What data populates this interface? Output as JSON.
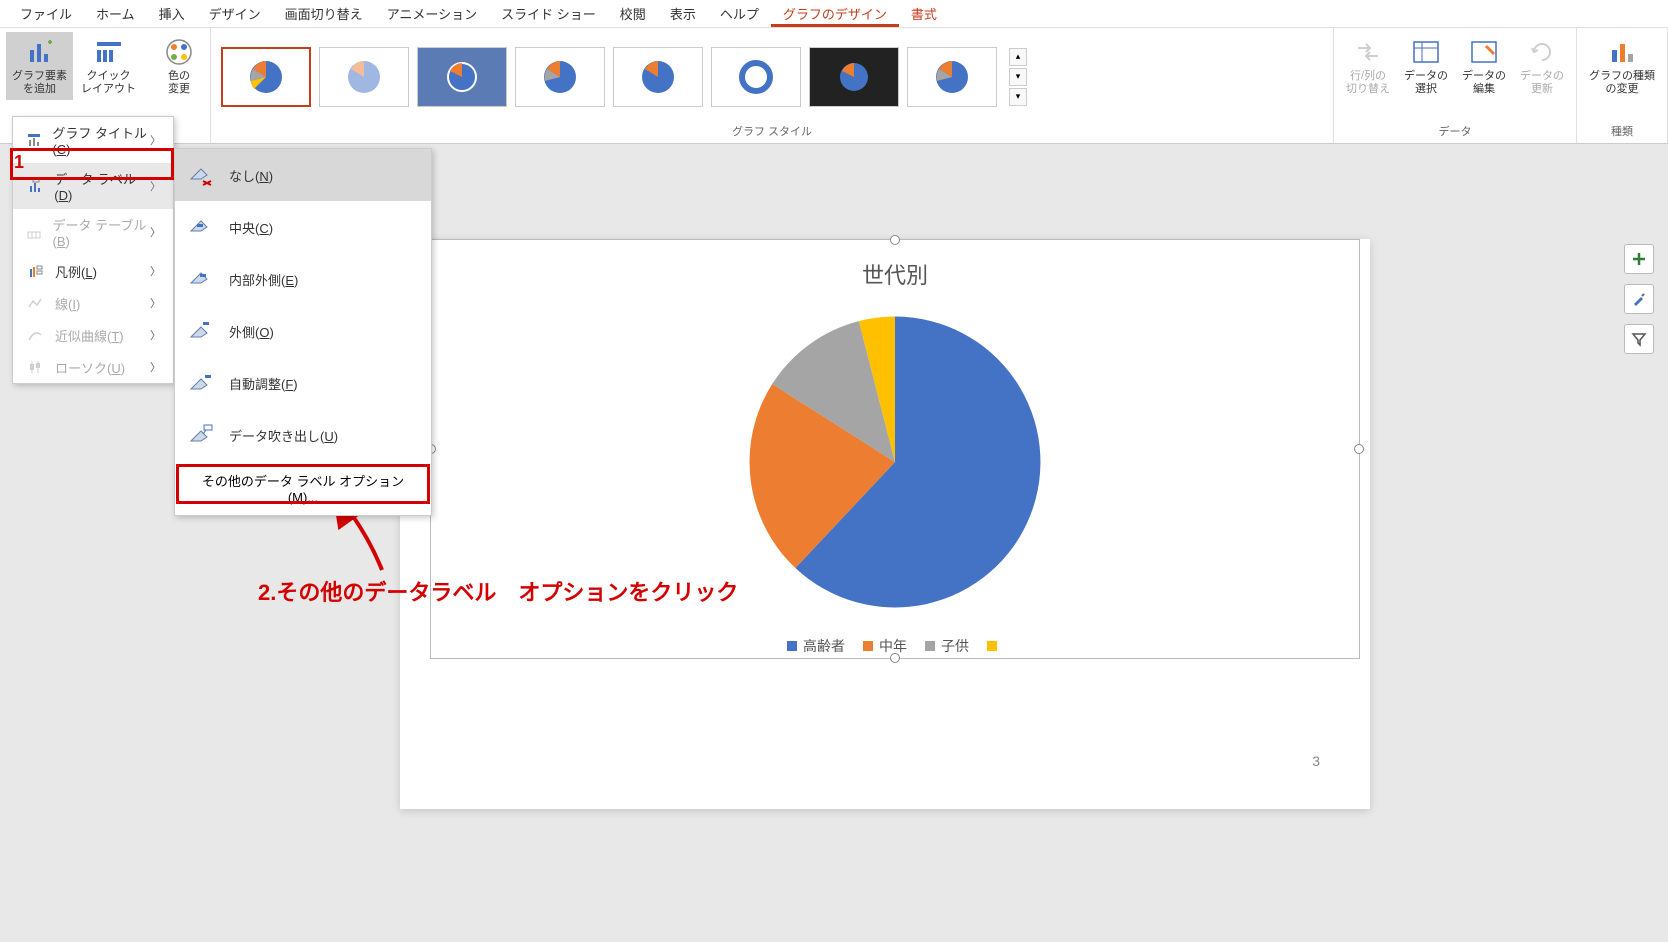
{
  "menubar": {
    "items": [
      "ファイル",
      "ホーム",
      "挿入",
      "デザイン",
      "画面切り替え",
      "アニメーション",
      "スライド ショー",
      "校閲",
      "表示",
      "ヘルプ",
      "グラフのデザイン",
      "書式"
    ],
    "active_index": 10
  },
  "ribbon": {
    "add_element": "グラフ要素\nを追加",
    "quick_layout": "クイック\nレイアウト",
    "change_colors": "色の\n変更",
    "styles_label": "グラフ スタイル",
    "data_group": {
      "label": "データ",
      "switch": "行/列の\n切り替え",
      "select": "データの\n選択",
      "edit": "データの\n編集",
      "refresh": "データの\n更新"
    },
    "type_group": {
      "label": "種類",
      "change_type": "グラフの種類\nの変更"
    }
  },
  "menu1": {
    "chart_title": "グラフ タイトル(",
    "chart_title_key": "C",
    "data_label": "データ ラベル(",
    "data_label_key": "D",
    "data_table": "データ テーブル(",
    "data_table_key": "B",
    "legend": "凡例(",
    "legend_key": "L",
    "lines": "線(",
    "lines_key": "I",
    "trendline": "近似曲線(",
    "trendline_key": "T",
    "candle": "ローソク(",
    "candle_key": "U"
  },
  "menu2": {
    "none": "なし(",
    "none_key": "N",
    "center": "中央(",
    "center_key": "C",
    "inside": "内部外側(",
    "inside_key": "E",
    "outside": "外側(",
    "outside_key": "O",
    "auto": "自動調整(",
    "auto_key": "F",
    "callout": "データ吹き出し(",
    "callout_key": "U",
    "more": "その他のデータ ラベル オプション(",
    "more_key": "M",
    "more_suffix": ")..."
  },
  "annotations": {
    "num1": "1",
    "text2": "2.その他のデータラベル　オプションをクリック"
  },
  "chart_data": {
    "type": "pie",
    "title": "世代別",
    "series": [
      {
        "name": "高齢者",
        "value": 62,
        "color": "#4472C4"
      },
      {
        "name": "中年",
        "value": 22,
        "color": "#ED7D31"
      },
      {
        "name": "子供",
        "value": 12,
        "color": "#A5A5A5"
      },
      {
        "name": "",
        "value": 4,
        "color": "#FFC000"
      }
    ]
  },
  "page_number": "3",
  "close_paren": ")"
}
